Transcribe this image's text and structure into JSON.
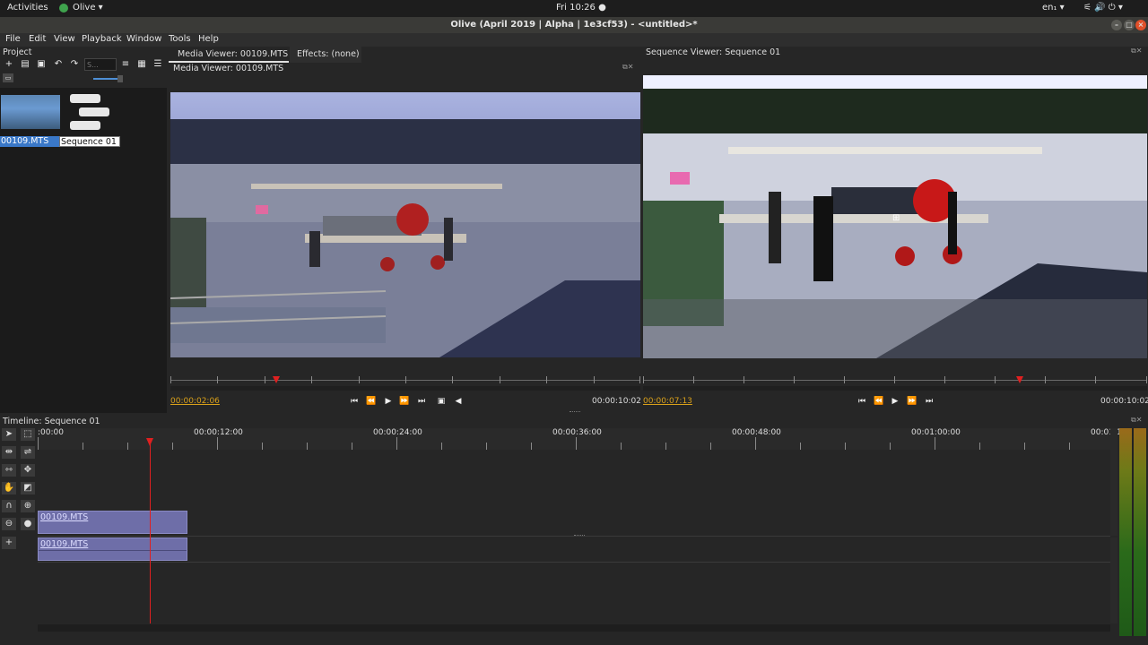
{
  "topbar": {
    "activities": "Activities",
    "app": "Olive ▾",
    "clock": "Fri 10:26 ●",
    "lang": "en₁ ▾",
    "tray": "⚟ 🔊 ⏻ ▾"
  },
  "window": {
    "title": "Olive (April 2019 | Alpha | 1e3cf53) - <untitled>*"
  },
  "menu": [
    "File",
    "Edit",
    "View",
    "Playback",
    "Window",
    "Tools",
    "Help"
  ],
  "project": {
    "title": "Project",
    "search_placeholder": "S...",
    "items": [
      {
        "label": "00109.MTS"
      },
      {
        "label": "Sequence 01"
      }
    ]
  },
  "tabs": {
    "media": "Media Viewer: 00109.MTS",
    "effects": "Effects: (none)"
  },
  "media_viewer": {
    "title": "Media Viewer: 00109.MTS",
    "current_tc": "00:00:02:06",
    "end_tc": "00:00:10:02"
  },
  "sequence_viewer": {
    "title": "Sequence Viewer: Sequence 01",
    "current_tc": "00:00:07:13",
    "end_tc": "00:00:10:02"
  },
  "timeline": {
    "title": "Timeline: Sequence 01",
    "ruler_labels": [
      ":00:00",
      "00:00:12:00",
      "00:00:24:00",
      "00:00:36:00",
      "00:00:48:00",
      "00:01:00:00",
      "00:01:1"
    ],
    "video_clip": "00109.MTS",
    "audio_clip": "00109.MTS"
  },
  "colors": {
    "accent_tc": "#d9a01a",
    "playhead": "#e02020",
    "clip": "#6e6ea8",
    "selection": "#3a78c8"
  }
}
